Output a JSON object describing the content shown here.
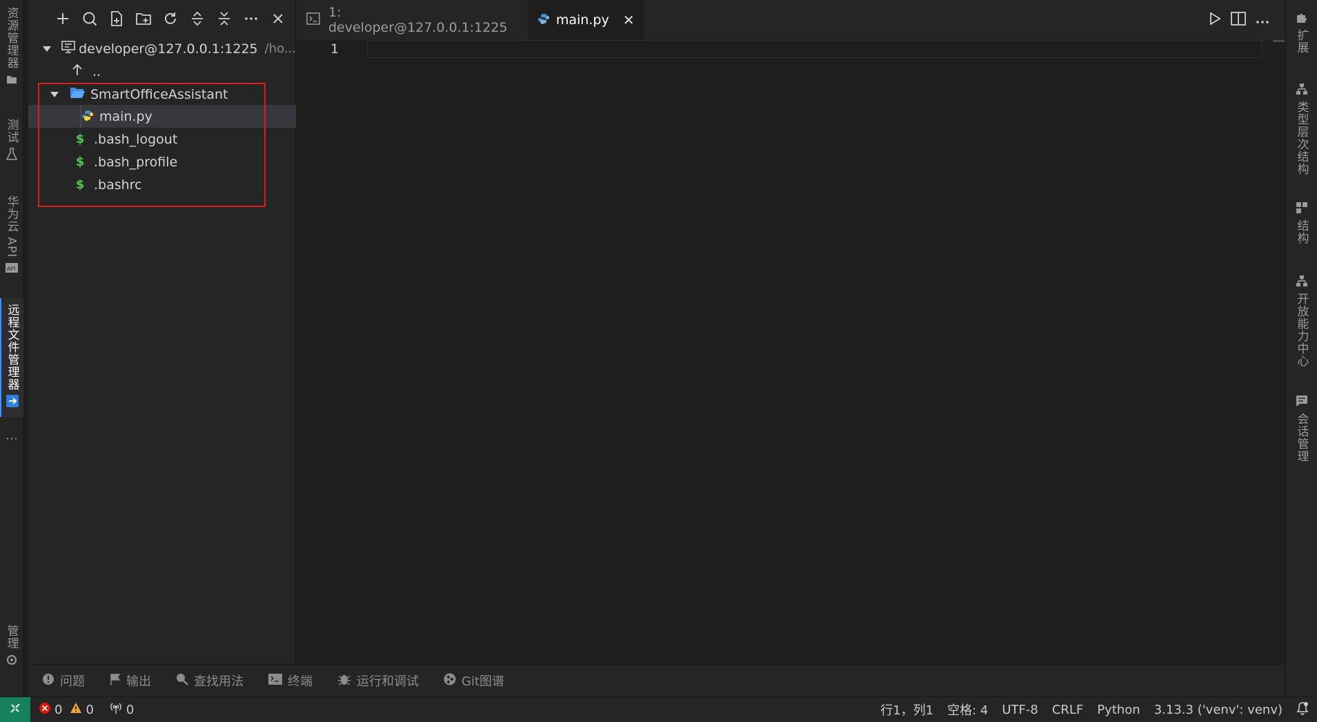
{
  "left_bar": {
    "tabs": [
      {
        "label": "资源管理器",
        "icon": "folder-icon"
      },
      {
        "label": "测试",
        "icon": "flask-icon"
      },
      {
        "label": "华为云 API",
        "icon": "api-icon"
      },
      {
        "label": "远程文件管理器",
        "icon": "remote-file-icon"
      }
    ],
    "bottom_label": "管理",
    "more_icon": "more-icon",
    "settings_icon": "gear-icon"
  },
  "right_bar": {
    "tabs": [
      {
        "label": "扩展",
        "icon": "puzzle-icon"
      },
      {
        "label": "类型层次结构",
        "icon": "hierarchy-icon"
      },
      {
        "label": "结构",
        "icon": "structure-icon"
      },
      {
        "label": "开放能力中心",
        "icon": "capability-icon"
      },
      {
        "label": "会话管理",
        "icon": "chat-icon"
      }
    ]
  },
  "explorer": {
    "toolbar": [
      "add-icon",
      "search-icon",
      "new-file-icon",
      "new-folder-icon",
      "refresh-icon",
      "expand-icon",
      "collapse-icon",
      "more-icon",
      "close-icon"
    ],
    "root": {
      "label": "developer@127.0.0.1:1225",
      "path": "/ho..."
    },
    "parent": "..",
    "items": [
      {
        "label": "SmartOfficeAssistant",
        "type": "folder"
      },
      {
        "label": "main.py",
        "type": "python"
      },
      {
        "label": ".bash_logout",
        "type": "shell"
      },
      {
        "label": ".bash_profile",
        "type": "shell"
      },
      {
        "label": ".bashrc",
        "type": "shell"
      }
    ]
  },
  "editor": {
    "tabs": [
      {
        "label": "1: developer@127.0.0.1:1225",
        "icon": "terminal-icon",
        "active": false
      },
      {
        "label": "main.py",
        "icon": "python-icon",
        "active": true,
        "close": "✕"
      }
    ],
    "line_numbers": [
      "1"
    ]
  },
  "panel_tabs": [
    {
      "label": "问题",
      "icon": "problems-icon"
    },
    {
      "label": "输出",
      "icon": "flag-icon"
    },
    {
      "label": "查找用法",
      "icon": "find-icon"
    },
    {
      "label": "终端",
      "icon": "terminal-icon"
    },
    {
      "label": "运行和调试",
      "icon": "debug-icon"
    },
    {
      "label": "Git图谱",
      "icon": "git-icon"
    }
  ],
  "status": {
    "errors": "0",
    "warnings": "0",
    "ports": "0",
    "position": "行1，列1",
    "spaces": "空格: 4",
    "encoding": "UTF-8",
    "eol": "CRLF",
    "language": "Python",
    "interpreter": "3.13.3 ('venv': venv)"
  },
  "colors": {
    "accent": "#3794ff",
    "remote": "#16825d",
    "highlight_box": "#e01b1b",
    "shell_icon": "#4ec94e"
  }
}
